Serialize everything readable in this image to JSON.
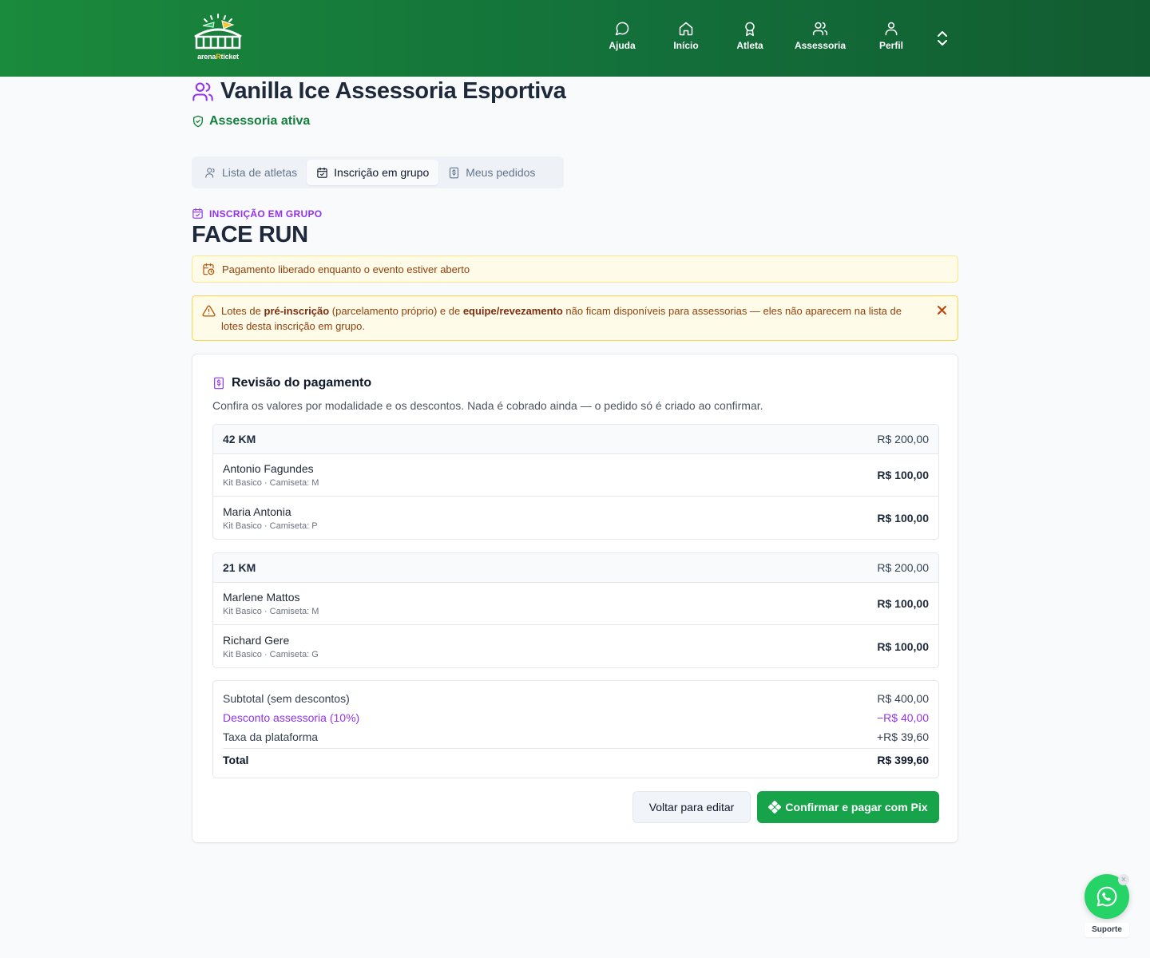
{
  "header": {
    "logo": {
      "text_left": "arena",
      "text_mid": "R",
      "text_right": "ticket"
    },
    "nav": [
      {
        "label": "Ajuda",
        "icon": "chat-bubble-icon"
      },
      {
        "label": "Início",
        "icon": "home-icon"
      },
      {
        "label": "Atleta",
        "icon": "medal-icon"
      },
      {
        "label": "Assessoria",
        "icon": "users-icon"
      },
      {
        "label": "Perfil",
        "icon": "user-icon"
      }
    ],
    "expand_icon": "chevrons-up-down-icon"
  },
  "page": {
    "title": "Vanilla Ice Assessoria Esportiva",
    "title_icon": "users-icon",
    "status": "Assessoria ativa",
    "status_color": "#15803d",
    "accent_color": "#9333ea"
  },
  "tabs": [
    {
      "label": "Lista de atletas",
      "icon": "user-icon",
      "active": false
    },
    {
      "label": "Inscrição em grupo",
      "icon": "calendar-check-icon",
      "active": true
    },
    {
      "label": "Meus pedidos",
      "icon": "receipt-icon",
      "active": false
    }
  ],
  "section": {
    "eyebrow": "INSCRIÇÃO EM GRUPO",
    "event_title": "FACE RUN"
  },
  "alerts": {
    "info": "Pagamento liberado enquanto o evento estiver aberto",
    "warning": {
      "part1": "Lotes de ",
      "bold1": "pré-inscrição",
      "part2": " (parcelamento próprio) e de ",
      "bold2": "equipe/revezamento",
      "part3": " não ficam disponíveis para assessorias — eles não aparecem na lista de lotes desta inscrição em grupo."
    }
  },
  "review": {
    "title": "Revisão do pagamento",
    "description": "Confira os valores por modalidade e os descontos. Nada é cobrado ainda — o pedido só é criado ao confirmar.",
    "groups": [
      {
        "name": "42 KM",
        "total": "R$ 200,00",
        "athletes": [
          {
            "name": "Antonio Fagundes",
            "meta": "Kit Basico · Camiseta: M",
            "price": "R$ 100,00"
          },
          {
            "name": "Maria Antonia",
            "meta": "Kit Basico · Camiseta: P",
            "price": "R$ 100,00"
          }
        ]
      },
      {
        "name": "21 KM",
        "total": "R$ 200,00",
        "athletes": [
          {
            "name": "Marlene Mattos",
            "meta": "Kit Basico · Camiseta: M",
            "price": "R$ 100,00"
          },
          {
            "name": "Richard Gere",
            "meta": "Kit Basico · Camiseta: G",
            "price": "R$ 100,00"
          }
        ]
      }
    ],
    "summary": {
      "subtotal_label": "Subtotal (sem descontos)",
      "subtotal_value": "R$ 400,00",
      "discount_label": "Desconto assessoria (10%)",
      "discount_value": "−R$ 40,00",
      "fee_label": "Taxa da plataforma",
      "fee_value": "+R$ 39,60",
      "total_label": "Total",
      "total_value": "R$ 399,60"
    },
    "buttons": {
      "back": "Voltar para editar",
      "confirm": "Confirmar e pagar com Pix"
    }
  },
  "support": {
    "label": "Suporte",
    "close": "×",
    "color": "#25d366"
  }
}
